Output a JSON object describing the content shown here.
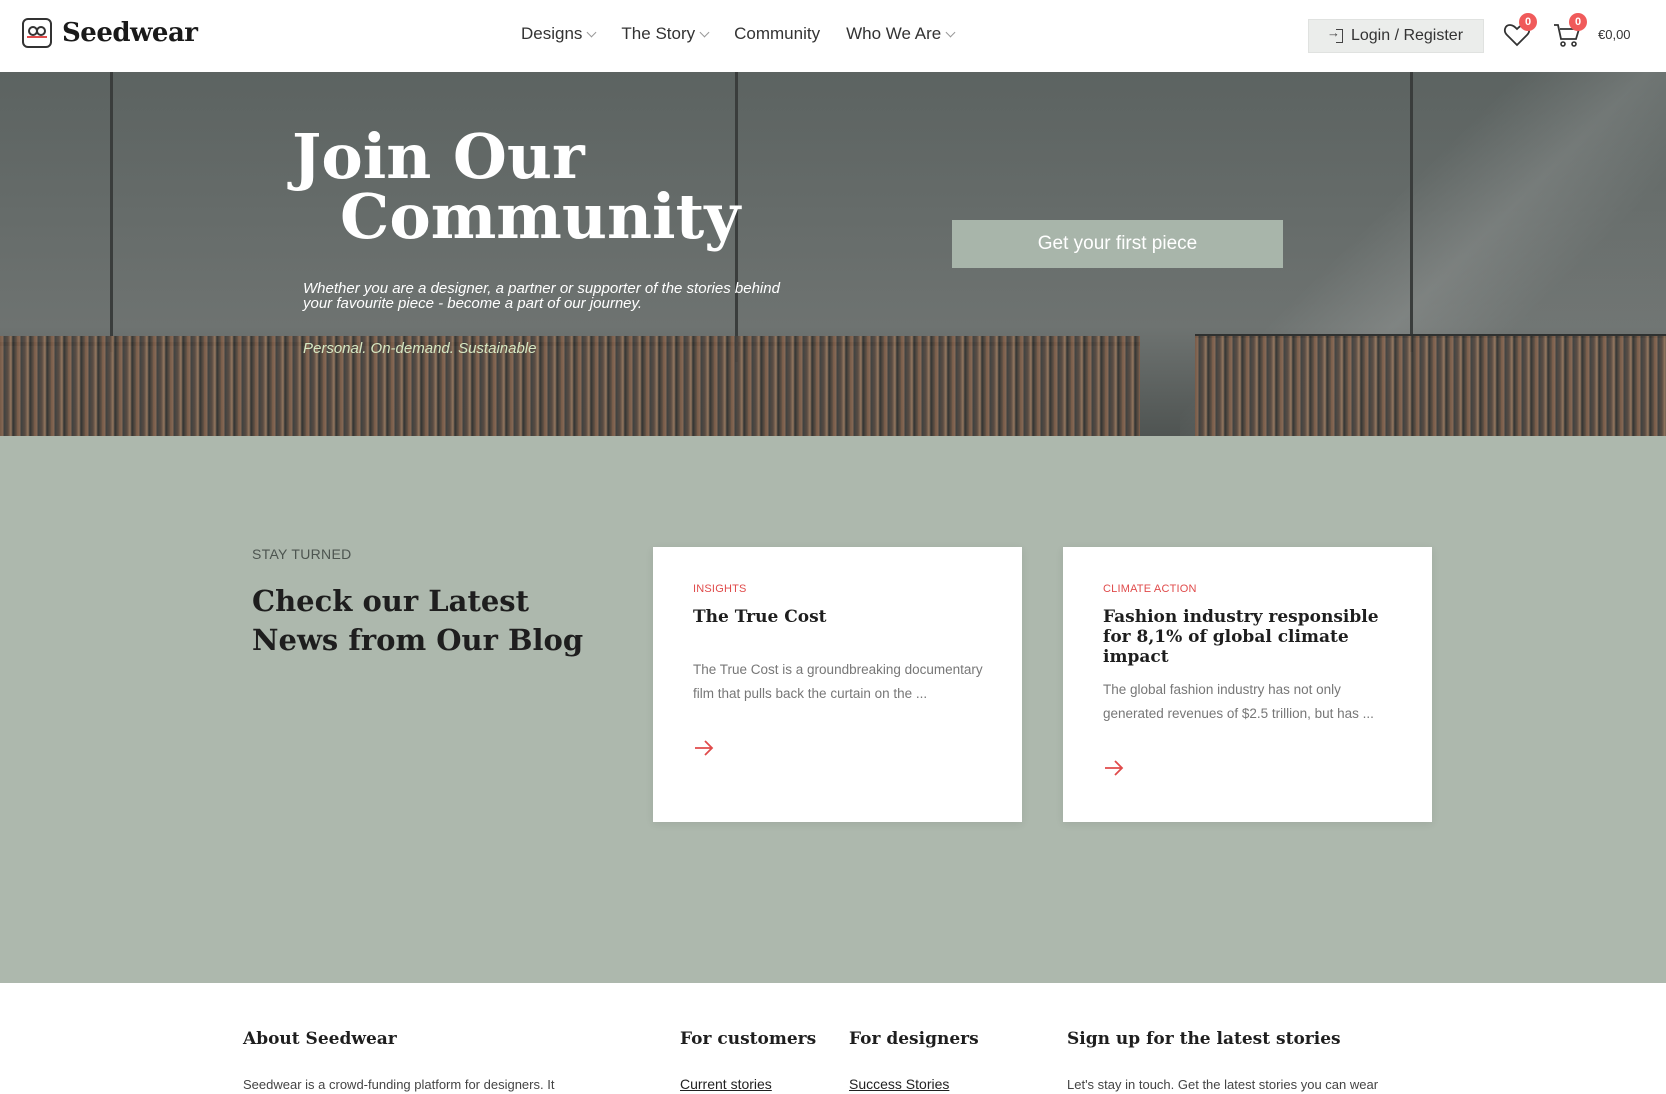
{
  "brand": {
    "name": "Seedwear"
  },
  "nav": {
    "items": [
      {
        "label": "Designs",
        "has_dropdown": true
      },
      {
        "label": "The Story",
        "has_dropdown": true
      },
      {
        "label": "Community",
        "has_dropdown": false
      },
      {
        "label": "Who We Are",
        "has_dropdown": true
      }
    ]
  },
  "header": {
    "login_label": "Login / Register",
    "wishlist_count": "0",
    "cart_count": "0",
    "cart_total": "€0,00",
    "icons": [
      "logo-icon",
      "login-icon",
      "heart-icon",
      "cart-icon"
    ]
  },
  "hero": {
    "title_line1": "Join Our",
    "title_line2": "Community",
    "subtitle": "Whether you are a designer, a partner or supporter of the stories behind your favourite piece - become a part of our journey.",
    "tagline": "Personal. On-demand. Sustainable",
    "cta_label": "Get your first piece"
  },
  "news": {
    "eyebrow": "STAY TURNED",
    "title": "Check our Latest News from Our Blog",
    "cards": [
      {
        "category": "INSIGHTS",
        "title": "The True Cost",
        "excerpt": "The True Cost is a groundbreaking documentary film that pulls back the curtain on the ..."
      },
      {
        "category": "CLIMATE ACTION",
        "title": "Fashion industry responsible for 8,1% of global climate impact",
        "excerpt": "The global fashion industry has not only generated revenues of $2.5 trillion, but has ..."
      }
    ]
  },
  "footer": {
    "about_title": "About Seedwear",
    "about_text": "Seedwear is a crowd-funding platform for designers. It",
    "customers_title": "For customers",
    "customers_link": "Current stories",
    "designers_title": "For designers",
    "designers_link": "Success Stories",
    "signup_title": "Sign up for the latest stories",
    "signup_text": "Let's stay in touch. Get the latest stories you can wear"
  },
  "colors": {
    "accent": "#e04b4b",
    "sage": "#adb8ad",
    "cta": "#a8b5aa",
    "tagline": "#d6e7c2"
  }
}
